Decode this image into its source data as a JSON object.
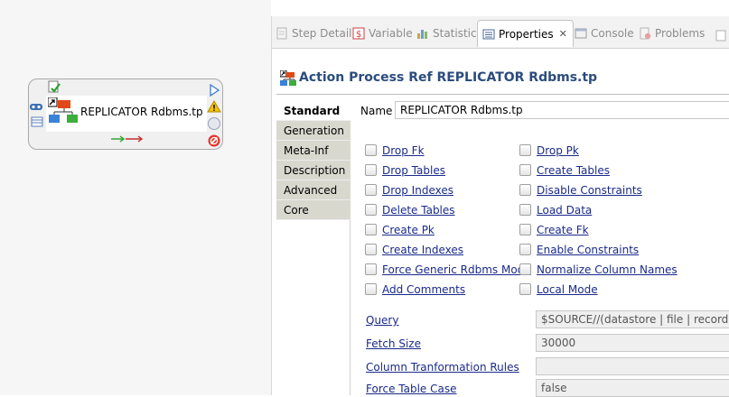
{
  "diagram": {
    "node_label": "REPLICATOR Rdbms.tp"
  },
  "tabs": [
    {
      "label": "Step Detail",
      "icon": "step-detail-icon"
    },
    {
      "label": "Variable",
      "icon": "variable-icon"
    },
    {
      "label": "Statistic",
      "icon": "statistic-icon"
    },
    {
      "label": "Properties",
      "icon": "properties-icon",
      "active": true
    },
    {
      "label": "Console",
      "icon": "console-icon"
    },
    {
      "label": "Problems",
      "icon": "problems-icon"
    }
  ],
  "view": {
    "title": "Action Process Ref REPLICATOR Rdbms.tp"
  },
  "side_tabs": [
    "Standard",
    "Generation",
    "Meta-Inf",
    "Description",
    "Advanced",
    "Core"
  ],
  "form": {
    "name_label": "Name",
    "name_value": "REPLICATOR Rdbms.tp",
    "checkboxes_left": [
      "Drop Fk",
      "Drop Tables",
      "Drop Indexes",
      "Delete Tables",
      "Create Pk",
      "Create Indexes",
      "Force Generic Rdbms Mode",
      "Add Comments"
    ],
    "checkboxes_right": [
      "Drop Pk",
      "Create Tables",
      "Disable Constraints",
      "Load Data",
      "Create Fk",
      "Enable Constraints",
      "Normalize Column Names",
      "Local Mode"
    ],
    "query_label": "Query",
    "query_value": "$SOURCE//(datastore | file | record)",
    "fetch_size_label": "Fetch Size",
    "fetch_size_value": "30000",
    "column_rules_label": "Column Tranformation Rules",
    "column_rules_value": "",
    "force_case_label": "Force Table Case",
    "force_case_value": "false"
  },
  "colors": {
    "title": "#2b4c7e",
    "link": "#1a2a8a",
    "side_tab_bg": "#d8d8cf"
  }
}
